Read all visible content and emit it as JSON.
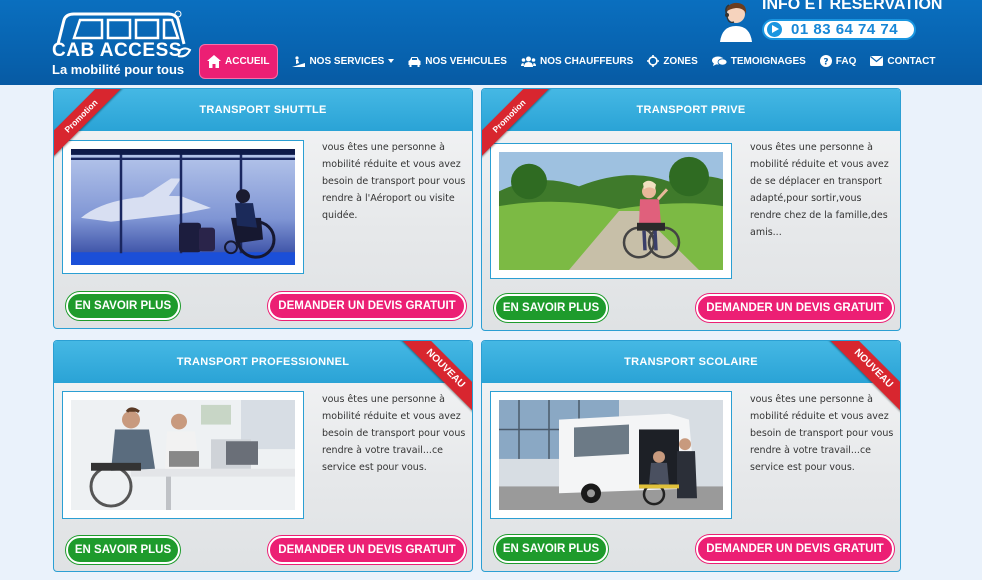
{
  "header": {
    "logo_title": "CAB ACCESS",
    "logo_tagline": "La mobilité pour tous",
    "info_title": "INFO ET RESERVATION",
    "phone": "01 83 64 74 74"
  },
  "nav": {
    "home": "ACCUEIL",
    "services": "NOS SERVICES",
    "vehicles": "NOS VEHICULES",
    "drivers": "NOS CHAUFFEURS",
    "zones": "ZONES",
    "testimonials": "TEMOIGNAGES",
    "faq": "FAQ",
    "contact": "CONTACT"
  },
  "cards": [
    {
      "title": "TRANSPORT SHUTTLE",
      "ribbon": "Promotion",
      "text": "vous êtes une personne à mobilité réduite et vous avez besoin de transport pour vous rendre à l'Aéroport ou visite quidée.",
      "more": "EN SAVOIR PLUS",
      "devis": "DEMANDER UN DEVIS GRATUIT"
    },
    {
      "title": "TRANSPORT PRIVE",
      "ribbon": "Promotion",
      "text": "vous êtes une personne à mobilité réduite et vous avez de se déplacer en transport adapté,pour sortir,vous rendre chez de la famille,des amis...",
      "more": "EN SAVOIR PLUS",
      "devis": "DEMANDER UN DEVIS GRATUIT"
    },
    {
      "title": "TRANSPORT PROFESSIONNEL",
      "ribbon": "NOUVEAU",
      "text": "vous êtes une personne à mobilité réduite et vous avez besoin de transport pour vous rendre à votre travail...ce service est pour vous.",
      "more": "EN SAVOIR PLUS",
      "devis": "DEMANDER UN DEVIS GRATUIT"
    },
    {
      "title": "TRANSPORT SCOLAIRE",
      "ribbon": "NOUVEAU",
      "text": "vous êtes une personne à mobilité réduite et vous avez besoin de transport pour vous rendre à votre travail...ce service est pour vous.",
      "more": "EN SAVOIR PLUS",
      "devis": "DEMANDER UN DEVIS GRATUIT"
    }
  ],
  "colors": {
    "header_blue": "#0761ad",
    "accent_pink": "#ec1f74",
    "button_green": "#1e9b2c",
    "card_header": "#2aa3d6",
    "ribbon_red": "#d8262f"
  }
}
